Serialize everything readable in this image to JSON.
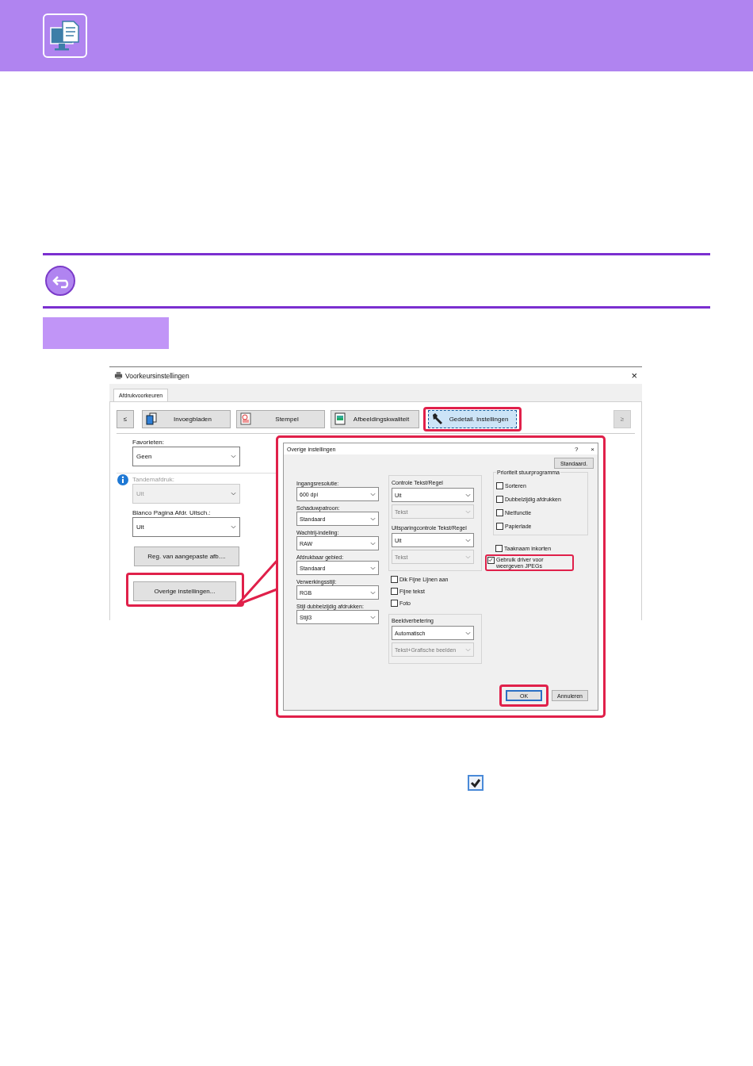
{
  "window": {
    "title": "Voorkeursinstellingen",
    "close": "×"
  },
  "tabs": [
    {
      "label": "Afdrukvoorkeuren",
      "selected": true
    }
  ],
  "toolbar": {
    "prev": {
      "label": "≤",
      "disabled": false
    },
    "next": {
      "label": "≥",
      "disabled": true
    },
    "items": [
      {
        "label": "Invoegbladen",
        "selected": false,
        "highlighted": false
      },
      {
        "label": "Stempel",
        "selected": false,
        "highlighted": false
      },
      {
        "label": "Afbeeldingskwaliteit",
        "selected": false,
        "highlighted": false
      },
      {
        "label": "Gedetail. Instellingen",
        "selected": true,
        "highlighted": true
      }
    ]
  },
  "fields": [
    {
      "label": "Favorieten:",
      "value": "Geen",
      "disabled": false,
      "info": false
    },
    {
      "label": "Tandemafdruk:",
      "value": "Uit",
      "disabled": true,
      "info": true
    },
    {
      "label": "Blanco Pagina Afdr. Uitsch.:",
      "value": "Uit",
      "disabled": false,
      "info": false
    }
  ],
  "buttons": [
    {
      "label": "Reg. van aangepaste afb....",
      "highlighted": false
    },
    {
      "label": "Overige instellingen...",
      "highlighted": true
    }
  ],
  "dialog": {
    "title": "Overige instellingen",
    "help": "?",
    "close": "×",
    "default_button": "Standaard.",
    "selects": [
      {
        "label": "Ingangsresolutie:",
        "value": "600 dpi"
      },
      {
        "label": "Schaduwpatroon:",
        "value": "Standaard"
      },
      {
        "label": "Wachtrij-indeling:",
        "value": "RAW"
      },
      {
        "label": "Afdrukbaar gebied:",
        "value": "Standaard"
      },
      {
        "label": "Verwerkingsstijl:",
        "value": "RGB"
      },
      {
        "label": "Stijl dubbelzijdig afdrukken:",
        "value": "Stijl3"
      }
    ],
    "text_control": [
      {
        "label": "Controle Tekst/Regel",
        "value": "Uit",
        "sub_value": "Tekst",
        "sub_disabled": true
      },
      {
        "label": "Uitsparingcontrole Tekst/Regel",
        "value": "Uit",
        "sub_value": "Tekst",
        "sub_disabled": true
      }
    ],
    "checks": [
      {
        "label": "Dik Fijne Lijnen aan",
        "checked": false
      },
      {
        "label": "Fijne tekst",
        "checked": false
      },
      {
        "label": "Foto",
        "checked": false
      }
    ],
    "enhancement": {
      "label": "Beeldverbetering",
      "value": "Automatisch",
      "sub_value": "Tekst+Grafische beelden",
      "sub_disabled": true
    },
    "priority": {
      "label": "Prioriteit stuurprogramma",
      "items": [
        {
          "label": "Sorteren",
          "checked": false
        },
        {
          "label": "Dubbelzijdig afdrukken",
          "checked": false
        },
        {
          "label": "Nietfunctie",
          "checked": false
        },
        {
          "label": "Papierlade",
          "checked": false
        }
      ]
    },
    "options": [
      {
        "label": "Taaknaam inkorten",
        "checked": false,
        "highlighted": false
      },
      {
        "label": "Gebruik driver voor weergeven JPEGs",
        "checked": true,
        "highlighted": true
      }
    ],
    "actions": [
      {
        "label": "OK",
        "highlighted": true
      },
      {
        "label": "Annuleren",
        "highlighted": false
      }
    ]
  }
}
